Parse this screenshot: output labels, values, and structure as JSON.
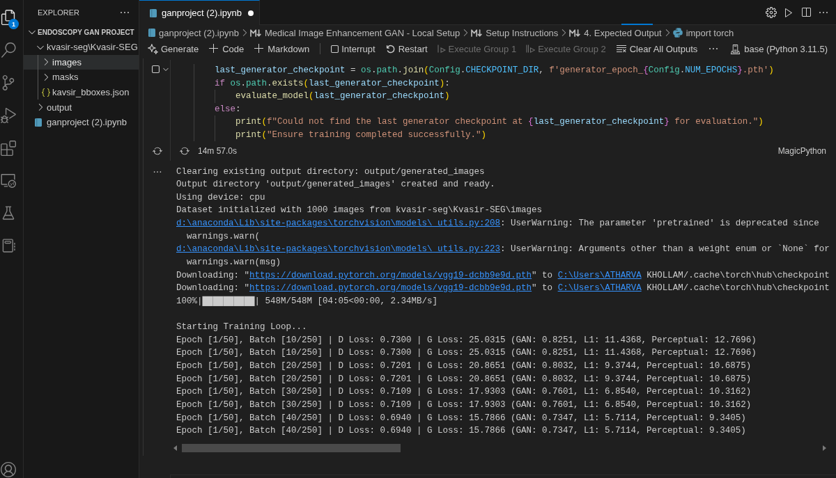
{
  "activity_bar": {
    "items": [
      {
        "selected": true,
        "badge": "1"
      },
      {
        "selected": false
      },
      {
        "selected": false
      },
      {
        "selected": false
      },
      {
        "selected": false
      },
      {
        "selected": false
      },
      {
        "selected": false
      },
      {
        "selected": false
      }
    ]
  },
  "sidebar": {
    "title": "EXPLORER",
    "section": {
      "title": "ENDOSCOPY GAN PROJECT",
      "expanded": true,
      "tree": [
        {
          "label": "kvasir-seg\\Kvasir-SEG",
          "kind": "folder",
          "expanded": true,
          "selected": false,
          "children": [
            {
              "label": "images",
              "kind": "folder",
              "expanded": false,
              "selected": true
            },
            {
              "label": "masks",
              "kind": "folder",
              "expanded": false,
              "selected": false
            },
            {
              "label": "kavsir_bboxes.json",
              "kind": "json",
              "selected": false
            }
          ]
        },
        {
          "label": "output",
          "kind": "folder",
          "expanded": false,
          "selected": false
        },
        {
          "label": "ganproject (2).ipynb",
          "kind": "notebook",
          "selected": false
        }
      ]
    }
  },
  "editor": {
    "tabs": [
      {
        "label": "ganproject (2).ipynb",
        "selected": true,
        "modified": true
      }
    ],
    "breadcrumb": [
      {
        "kind": "notebook",
        "text": "ganproject (2).ipynb"
      },
      {
        "kind": "markdown",
        "text": "Medical Image Enhancement GAN - Local Setup"
      },
      {
        "kind": "markdown",
        "text": "Setup Instructions"
      },
      {
        "kind": "markdown",
        "text": "4. Expected Output"
      },
      {
        "kind": "python",
        "text": "import torch"
      }
    ],
    "toolbar": {
      "groups": [
        [
          {
            "label": "Generate",
            "disabled": false
          },
          {
            "label": "Code",
            "disabled": false
          },
          {
            "label": "Markdown",
            "disabled": false
          }
        ],
        [
          {
            "label": "Interrupt",
            "disabled": false
          },
          {
            "label": "Restart",
            "disabled": false
          },
          {
            "label": "Execute Group 1",
            "disabled": true
          },
          {
            "label": "Execute Group 2",
            "disabled": true
          },
          {
            "label": "Clear All Outputs",
            "disabled": false
          }
        ]
      ],
      "kernel": "base (Python 3.11.5)"
    },
    "cell": {
      "running": true,
      "lines": [
        {
          "tokens": [
            {
              "kind": "variable",
              "text": "    last_generator_checkpoint"
            },
            {
              "kind": "plain",
              "text": " = "
            },
            {
              "kind": "type",
              "text": "os"
            },
            {
              "kind": "plain",
              "text": "."
            },
            {
              "kind": "type",
              "text": "path"
            },
            {
              "kind": "plain",
              "text": "."
            },
            {
              "kind": "function",
              "text": "join"
            },
            {
              "kind": "bracket",
              "text": "("
            },
            {
              "kind": "type",
              "text": "Config"
            },
            {
              "kind": "plain",
              "text": "."
            },
            {
              "kind": "constant",
              "text": "CHECKPOINT_DIR"
            },
            {
              "kind": "plain",
              "text": ", "
            },
            {
              "kind": "string",
              "text": "f'generator_epoch_"
            },
            {
              "kind": "brace",
              "text": "{"
            },
            {
              "kind": "type",
              "text": "Config"
            },
            {
              "kind": "plain",
              "text": "."
            },
            {
              "kind": "constant",
              "text": "NUM_EPOCHS"
            },
            {
              "kind": "brace",
              "text": "}"
            },
            {
              "kind": "string",
              "text": ".pth'"
            },
            {
              "kind": "bracket",
              "text": ")"
            }
          ]
        },
        {
          "tokens": [
            {
              "kind": "keyword",
              "text": "    if"
            },
            {
              "kind": "type",
              "text": " os"
            },
            {
              "kind": "plain",
              "text": "."
            },
            {
              "kind": "type",
              "text": "path"
            },
            {
              "kind": "plain",
              "text": "."
            },
            {
              "kind": "function",
              "text": "exists"
            },
            {
              "kind": "bracket",
              "text": "("
            },
            {
              "kind": "variable",
              "text": "last_generator_checkpoint"
            },
            {
              "kind": "bracket",
              "text": ")"
            },
            {
              "kind": "plain",
              "text": ":"
            }
          ]
        },
        {
          "tokens": [
            {
              "kind": "function",
              "text": "        evaluate_model"
            },
            {
              "kind": "bracket",
              "text": "("
            },
            {
              "kind": "variable",
              "text": "last_generator_checkpoint"
            },
            {
              "kind": "bracket",
              "text": ")"
            }
          ]
        },
        {
          "tokens": [
            {
              "kind": "keyword",
              "text": "    else"
            },
            {
              "kind": "plain",
              "text": ":"
            }
          ]
        },
        {
          "tokens": [
            {
              "kind": "function",
              "text": "        print"
            },
            {
              "kind": "bracket",
              "text": "("
            },
            {
              "kind": "string",
              "text": "f\"Could not find the last generator checkpoint at "
            },
            {
              "kind": "brace",
              "text": "{"
            },
            {
              "kind": "variable",
              "text": "last_generator_checkpoint"
            },
            {
              "kind": "brace",
              "text": "}"
            },
            {
              "kind": "string",
              "text": " for evaluation.\""
            },
            {
              "kind": "bracket",
              "text": ")"
            }
          ]
        },
        {
          "tokens": [
            {
              "kind": "function",
              "text": "        print"
            },
            {
              "kind": "bracket",
              "text": "("
            },
            {
              "kind": "string",
              "text": "\"Ensure training completed successfully.\""
            },
            {
              "kind": "bracket",
              "text": ")"
            }
          ]
        }
      ],
      "elapsed": "14m 57.0s",
      "language": "MagicPython"
    },
    "output": {
      "groups": [
        {
          "lines": [
            {
              "parts": [
                {
                  "kind": "text",
                  "text": "Clearing existing output directory: output/generated_images"
                }
              ]
            },
            {
              "parts": [
                {
                  "kind": "text",
                  "text": "Output directory 'output/generated_images' created and ready."
                }
              ]
            },
            {
              "parts": [
                {
                  "kind": "text",
                  "text": "Using device: cpu"
                }
              ]
            },
            {
              "parts": [
                {
                  "kind": "text",
                  "text": "Dataset initialized with 1000 images from kvasir-seg\\Kvasir-SEG\\images"
                }
              ]
            },
            {
              "parts": [
                {
                  "kind": "link",
                  "text": "d:\\anaconda\\Lib\\site-packages\\torchvision\\models\\_utils.py:208"
                },
                {
                  "kind": "text",
                  "text": ": UserWarning: The parameter 'pretrained' is deprecated since"
                }
              ]
            },
            {
              "parts": [
                {
                  "kind": "text",
                  "text": "  warnings.warn("
                }
              ]
            },
            {
              "parts": [
                {
                  "kind": "link",
                  "text": "d:\\anaconda\\Lib\\site-packages\\torchvision\\models\\_utils.py:223"
                },
                {
                  "kind": "text",
                  "text": ": UserWarning: Arguments other than a weight enum or `None` for"
                }
              ]
            },
            {
              "parts": [
                {
                  "kind": "text",
                  "text": "  warnings.warn(msg)"
                }
              ]
            },
            {
              "parts": [
                {
                  "kind": "text",
                  "text": "Downloading: \""
                },
                {
                  "kind": "link",
                  "text": "https://download.pytorch.org/models/vgg19-dcbb9e9d.pth"
                },
                {
                  "kind": "text",
                  "text": "\" to "
                },
                {
                  "kind": "link",
                  "text": "C:\\Users\\ATHARVA"
                },
                {
                  "kind": "text",
                  "text": " KHOLLAM/.cache\\torch\\hub\\checkpoint"
                }
              ]
            },
            {
              "parts": [
                {
                  "kind": "text",
                  "text": "Downloading: \""
                },
                {
                  "kind": "link",
                  "text": "https://download.pytorch.org/models/vgg19-dcbb9e9d.pth"
                },
                {
                  "kind": "text",
                  "text": "\" to "
                },
                {
                  "kind": "link",
                  "text": "C:\\Users\\ATHARVA"
                },
                {
                  "kind": "text",
                  "text": " KHOLLAM/.cache\\torch\\hub\\checkpoint"
                }
              ]
            },
            {
              "parts": [
                {
                  "kind": "text",
                  "text": "100%|██████████| 548M/548M [04:05<00:00, 2.34MB/s]"
                }
              ]
            }
          ]
        },
        {
          "lines": [
            {
              "parts": [
                {
                  "kind": "text",
                  "text": "Starting Training Loop..."
                }
              ]
            },
            {
              "parts": [
                {
                  "kind": "text",
                  "text": "Epoch [1/50], Batch [10/250] | D Loss: 0.7300 | G Loss: 25.0315 (GAN: 0.8251, L1: 11.4368, Perceptual: 12.7696)"
                }
              ]
            },
            {
              "parts": [
                {
                  "kind": "text",
                  "text": "Epoch [1/50], Batch [10/250] | D Loss: 0.7300 | G Loss: 25.0315 (GAN: 0.8251, L1: 11.4368, Perceptual: 12.7696)"
                }
              ]
            },
            {
              "parts": [
                {
                  "kind": "text",
                  "text": "Epoch [1/50], Batch [20/250] | D Loss: 0.7201 | G Loss: 20.8651 (GAN: 0.8032, L1: 9.3744, Perceptual: 10.6875)"
                }
              ]
            },
            {
              "parts": [
                {
                  "kind": "text",
                  "text": "Epoch [1/50], Batch [20/250] | D Loss: 0.7201 | G Loss: 20.8651 (GAN: 0.8032, L1: 9.3744, Perceptual: 10.6875)"
                }
              ]
            },
            {
              "parts": [
                {
                  "kind": "text",
                  "text": "Epoch [1/50], Batch [30/250] | D Loss: 0.7109 | G Loss: 17.9303 (GAN: 0.7601, L1: 6.8540, Perceptual: 10.3162)"
                }
              ]
            },
            {
              "parts": [
                {
                  "kind": "text",
                  "text": "Epoch [1/50], Batch [30/250] | D Loss: 0.7109 | G Loss: 17.9303 (GAN: 0.7601, L1: 6.8540, Perceptual: 10.3162)"
                }
              ]
            },
            {
              "parts": [
                {
                  "kind": "text",
                  "text": "Epoch [1/50], Batch [40/250] | D Loss: 0.6940 | G Loss: 15.7866 (GAN: 0.7347, L1: 5.7114, Perceptual: 9.3405)"
                }
              ]
            },
            {
              "parts": [
                {
                  "kind": "text",
                  "text": "Epoch [1/50], Batch [40/250] | D Loss: 0.6940 | G Loss: 15.7866 (GAN: 0.7347, L1: 5.7114, Perceptual: 9.3405)"
                }
              ]
            }
          ]
        }
      ]
    }
  }
}
